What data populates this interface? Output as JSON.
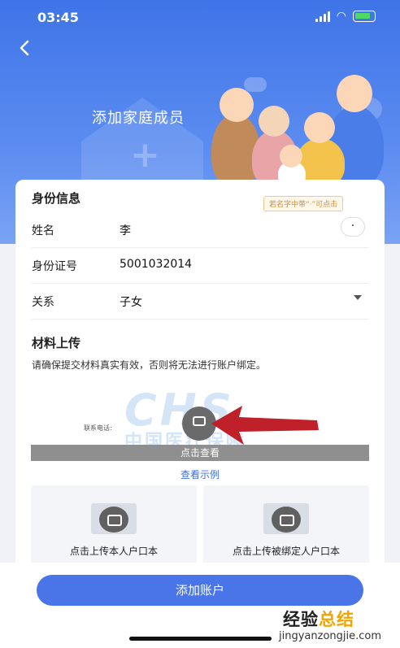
{
  "status_bar": {
    "time": "03:45",
    "icons": [
      "signal-icon",
      "wifi-icon",
      "battery-charging-icon"
    ]
  },
  "header": {
    "back_icon": "chevron-left-icon",
    "title": "添加家庭成员"
  },
  "identity": {
    "section_title": "身份信息",
    "tip": "若名字中带“·”可点击",
    "name_label": "姓名",
    "name_value": "李",
    "dot_button": "·",
    "id_label": "身份证号",
    "id_value": "5001032014",
    "relation_label": "关系",
    "relation_value": "子女"
  },
  "upload": {
    "section_title": "材料上传",
    "note": "请确保提交材料真实有效，否则将无法进行账户绑定。",
    "sample_contact_label": "联系电话:",
    "view_bar": "点击查看",
    "example_link": "查看示例",
    "tile_self": "点击上传本人户口本",
    "tile_bound": "点击上传被绑定人户口本"
  },
  "footer": {
    "submit": "添加账户"
  },
  "watermark": {
    "brand_part1": "经验",
    "brand_part2": "总结",
    "url": "jingyanzongjie.com"
  },
  "colors": {
    "primary": "#4a75e8",
    "link": "#3e6fe0",
    "tip": "#d98a2b",
    "arrow": "#c0202a"
  }
}
